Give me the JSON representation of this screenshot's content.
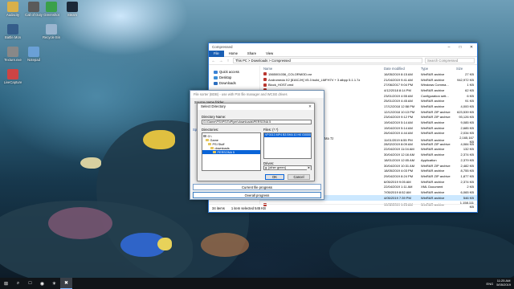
{
  "desktop": {
    "icons": [
      {
        "label": "Audacity",
        "color": "#d8b04a"
      },
      {
        "label": "Call of Duty",
        "color": "#5a5a5a"
      },
      {
        "label": "Greenshot",
        "color": "#3aa04a"
      },
      {
        "label": "Steam",
        "color": "#1b2838"
      },
      {
        "label": "Battle.Mon",
        "color": "#355d8a"
      },
      {
        "label": "Recycle Bin",
        "color": "#9ab5cf"
      },
      {
        "label": "Texture.exe",
        "color": "#888"
      },
      {
        "label": "Notepad",
        "color": "#6aa0d6"
      },
      {
        "label": "LiveCapture",
        "color": "#c44"
      }
    ]
  },
  "explorer": {
    "title": "Compressed",
    "ribbon_tabs": [
      "File",
      "Home",
      "Share",
      "View"
    ],
    "address_path": "This PC  >  Downloads  >  Compressed",
    "search_placeholder": "Search Compressed",
    "nav_items": [
      "Quick access",
      "Desktop",
      "Downloads"
    ],
    "columns": [
      "Name",
      "Date modified",
      "Type",
      "Size"
    ],
    "rows": [
      {
        "name": "1565001036_COLORMOD.rar",
        "date": "16/05/2019 8:15 AM",
        "type": "WinRAR archive",
        "size": "27 KB",
        "sel": false
      },
      {
        "name": "Andromeda X2 [816CJH] V5.3 build_LMFH7V + 3 albpp 5.1.1.7z",
        "date": "21/04/2019 9:41 AM",
        "type": "WinRAR archive",
        "size": "942,972 KB",
        "sel": false
      },
      {
        "name": "Block_HOST.cmd",
        "date": "27/06/2017 9:04 PM",
        "type": "Windows Comma...",
        "size": "1 KB",
        "sel": false
      },
      {
        "name": "",
        "date": "4/12/2018 8:14 PM",
        "type": "WinRAR archive",
        "size": "62 KB",
        "sel": false
      },
      {
        "name": "",
        "date": "23/01/2019 4:55 AM",
        "type": "Configuration sett...",
        "size": "6 KB",
        "sel": false
      },
      {
        "name": "",
        "date": "25/01/2019 4:45 AM",
        "type": "WinRAR archive",
        "size": "91 KB",
        "sel": false
      },
      {
        "name": "",
        "date": "17/12/2018 12:58 PM",
        "type": "WinRAR archive",
        "size": "4,000 KB",
        "sel": false
      },
      {
        "name": "",
        "date": "12/12/2018 10:13 PM",
        "type": "WinRAR ZIP archive",
        "size": "623,539 KB",
        "sel": false
      },
      {
        "name": "",
        "date": "23/04/2019 9:12 PM",
        "type": "WinRAR ZIP archive",
        "size": "93,126 KB",
        "sel": false
      },
      {
        "name": "",
        "date": "19/04/2019 5:14 AM",
        "type": "WinRAR archive",
        "size": "9,085 KB",
        "sel": false
      },
      {
        "name": "",
        "date": "19/04/2019 5:14 AM",
        "type": "WinRAR archive",
        "size": "2,685 KB",
        "sel": false
      },
      {
        "name": "",
        "date": "26/04/2019 4:44 AM",
        "type": "WinRAR archive",
        "size": "2,034 KB",
        "sel": false
      },
      {
        "name": "",
        "date": "11/01/2019 6:55 PM",
        "type": "WinRAR archive",
        "size": "2,165,167 KB",
        "sel": false
      },
      {
        "name": "",
        "date": "28/02/2019 8:09 AM",
        "type": "WinRAR ZIP archive",
        "size": "4,084 KB",
        "sel": false
      },
      {
        "name": "",
        "date": "22/04/2019 11:04 AM",
        "type": "WinRAR archive",
        "size": "132 KB",
        "sel": false
      },
      {
        "name": "",
        "date": "30/04/2019 12:16 AM",
        "type": "WinRAR archive",
        "size": "2,374 KB",
        "sel": false
      },
      {
        "name": "",
        "date": "18/01/2019 12:05 AM",
        "type": "Application",
        "size": "2,379 KB",
        "sel": false
      },
      {
        "name": "",
        "date": "30/04/2019 10:31 AM",
        "type": "WinRAR ZIP archive",
        "size": "2,482 KB",
        "sel": false
      },
      {
        "name": "",
        "date": "18/05/2019 4:03 PM",
        "type": "WinRAR archive",
        "size": "8,755 KB",
        "sel": false
      },
      {
        "name": "",
        "date": "29/04/2019 8:24 PM",
        "type": "WinRAR ZIP archive",
        "size": "1,877 KB",
        "sel": false
      },
      {
        "name": "",
        "date": "6/05/2019 9:05 AM",
        "type": "WinRAR archive",
        "size": "2,374 KB",
        "sel": false
      },
      {
        "name": "",
        "date": "22/04/2019 1:11 AM",
        "type": "XML Document",
        "size": "2 KB",
        "sel": false
      },
      {
        "name": "",
        "date": "7/05/2019 8:52 AM",
        "type": "WinRAR archive",
        "size": "6,065 KB",
        "sel": false
      },
      {
        "name": "",
        "date": "4/05/2019 7:39 PM",
        "type": "WinRAR archive",
        "size": "546 KB",
        "sel": true
      },
      {
        "name": "",
        "date": "19/02/2019 1:25 AM",
        "type": "WinRAR archive",
        "size": "1,158,111 KB",
        "sel": false
      }
    ],
    "status_count": "34 items",
    "status_selected": "1 item selected  545 KB"
  },
  "sorter": {
    "title": "File sorter (BDB) - use with PSI file manager and WCSE drives",
    "source_label": "Source game folder",
    "sp_label": "Sp",
    "partial_text": "Ma 7z",
    "current_progress": "Current file progress",
    "overall_progress": "Overall progress",
    "current_level": 0,
    "overall_level": 0
  },
  "select_dir": {
    "title": "Select Directory",
    "dirname_label": "Directory Name:",
    "dirname_value": "G:\\Game\\PSI\\PS\\ToPlyer\\downloads\\PERSONA 5",
    "dirs_label": "Directories:",
    "files_label": "Files: (*.*)",
    "tree": [
      "G:\\",
      "Game",
      "PSI Stuff",
      "downloads",
      "PERSONA 5"
    ],
    "file_item": "VF0013 MP4 B3 BHA 10 H0 G0000 80",
    "drives_label": "Drives:",
    "drive_value": "g: [other green]",
    "ok": "OK",
    "cancel": "Cancel"
  },
  "taskbar": {
    "apps": [
      "⊞",
      "⌕",
      "□",
      "◉",
      "☀",
      "✖"
    ],
    "lang": "ENG",
    "time": "11:25 AM",
    "date": "5/05/2019"
  }
}
